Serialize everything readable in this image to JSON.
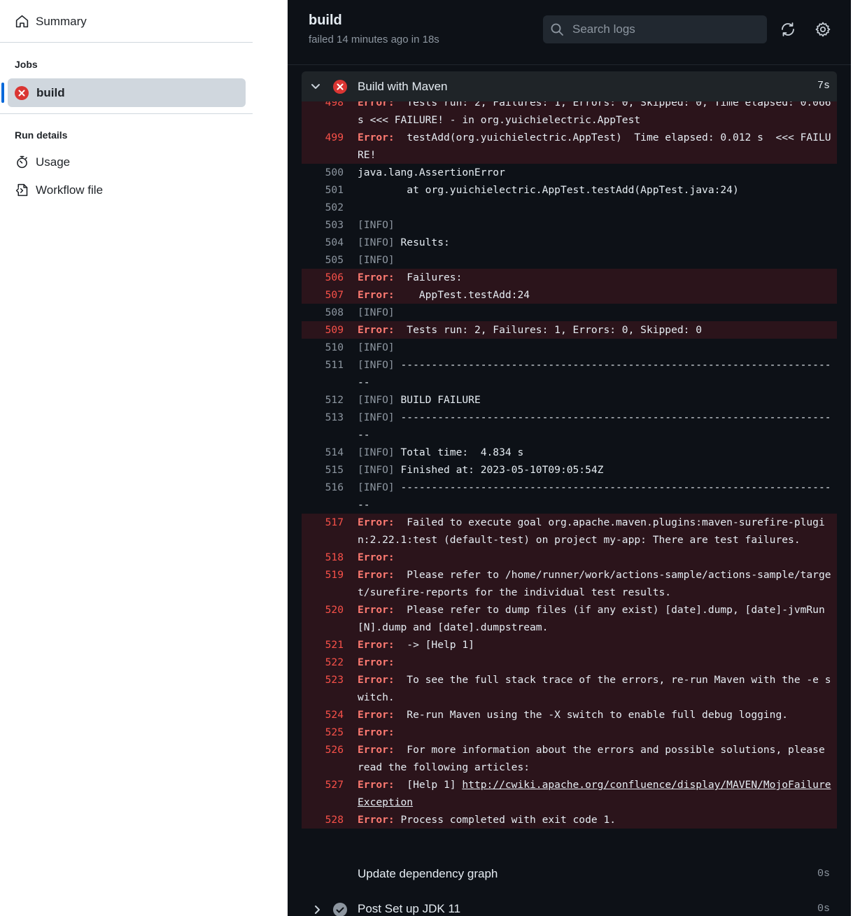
{
  "sidebar": {
    "summary_label": "Summary",
    "jobs_heading": "Jobs",
    "jobs": [
      {
        "label": "build",
        "status": "failed"
      }
    ],
    "run_details_heading": "Run details",
    "usage_label": "Usage",
    "workflow_file_label": "Workflow file"
  },
  "header": {
    "title": "build",
    "subtitle": "failed 14 minutes ago in 18s",
    "search_placeholder": "Search logs"
  },
  "step": {
    "name": "Build with Maven",
    "duration": "7s",
    "status": "failed",
    "lines": [
      {
        "num": "498",
        "err": true,
        "label": "Error:",
        "text": "  Tests run: 2, Failures: 1, Errors: 0, Skipped: 0, Time elapsed: 0.066 s <<< FAILURE! - in org.yuichielectric.AppTest"
      },
      {
        "num": "499",
        "err": true,
        "label": "Error:",
        "text": "  testAdd(org.yuichielectric.AppTest)  Time elapsed: 0.012 s  <<< FAILURE!"
      },
      {
        "num": "500",
        "err": false,
        "text": "java.lang.AssertionError"
      },
      {
        "num": "501",
        "err": false,
        "text": "\tat org.yuichielectric.AppTest.testAdd(AppTest.java:24)"
      },
      {
        "num": "502",
        "err": false,
        "text": ""
      },
      {
        "num": "503",
        "err": false,
        "info": "[INFO]",
        "text": ""
      },
      {
        "num": "504",
        "err": false,
        "info": "[INFO]",
        "text": " Results:"
      },
      {
        "num": "505",
        "err": false,
        "info": "[INFO]",
        "text": ""
      },
      {
        "num": "506",
        "err": true,
        "label": "Error:",
        "text": "  Failures: "
      },
      {
        "num": "507",
        "err": true,
        "label": "Error:",
        "text": "    AppTest.testAdd:24"
      },
      {
        "num": "508",
        "err": false,
        "info": "[INFO]",
        "text": ""
      },
      {
        "num": "509",
        "err": true,
        "label": "Error:",
        "text": "  Tests run: 2, Failures: 1, Errors: 0, Skipped: 0"
      },
      {
        "num": "510",
        "err": false,
        "info": "[INFO]",
        "text": ""
      },
      {
        "num": "511",
        "err": false,
        "info": "[INFO]",
        "text": " ------------------------------------------------------------------------"
      },
      {
        "num": "512",
        "err": false,
        "info": "[INFO]",
        "text": " BUILD FAILURE"
      },
      {
        "num": "513",
        "err": false,
        "info": "[INFO]",
        "text": " ------------------------------------------------------------------------"
      },
      {
        "num": "514",
        "err": false,
        "info": "[INFO]",
        "text": " Total time:  4.834 s"
      },
      {
        "num": "515",
        "err": false,
        "info": "[INFO]",
        "text": " Finished at: 2023-05-10T09:05:54Z"
      },
      {
        "num": "516",
        "err": false,
        "info": "[INFO]",
        "text": " ------------------------------------------------------------------------"
      },
      {
        "num": "517",
        "err": true,
        "label": "Error:",
        "text": "  Failed to execute goal org.apache.maven.plugins:maven-surefire-plugin:2.22.1:test (default-test) on project my-app: There are test failures."
      },
      {
        "num": "518",
        "err": true,
        "label": "Error:",
        "text": " "
      },
      {
        "num": "519",
        "err": true,
        "label": "Error:",
        "text": "  Please refer to /home/runner/work/actions-sample/actions-sample/target/surefire-reports for the individual test results."
      },
      {
        "num": "520",
        "err": true,
        "label": "Error:",
        "text": "  Please refer to dump files (if any exist) [date].dump, [date]-jvmRun[N].dump and [date].dumpstream."
      },
      {
        "num": "521",
        "err": true,
        "label": "Error:",
        "text": "  -> [Help 1]"
      },
      {
        "num": "522",
        "err": true,
        "label": "Error:",
        "text": " "
      },
      {
        "num": "523",
        "err": true,
        "label": "Error:",
        "text": "  To see the full stack trace of the errors, re-run Maven with the -e switch."
      },
      {
        "num": "524",
        "err": true,
        "label": "Error:",
        "text": "  Re-run Maven using the -X switch to enable full debug logging."
      },
      {
        "num": "525",
        "err": true,
        "label": "Error:",
        "text": " "
      },
      {
        "num": "526",
        "err": true,
        "label": "Error:",
        "text": "  For more information about the errors and possible solutions, please read the following articles:"
      },
      {
        "num": "527",
        "err": true,
        "label": "Error:",
        "text": "  [Help 1] ",
        "link": "http://cwiki.apache.org/confluence/display/MAVEN/MojoFailureException"
      },
      {
        "num": "528",
        "err": true,
        "label": "Error:",
        "text": " Process completed with exit code 1."
      }
    ]
  },
  "other_steps": [
    {
      "name": "Update dependency graph",
      "duration": "0s",
      "status": "none"
    },
    {
      "name": "Post Set up JDK 11",
      "duration": "0s",
      "status": "success"
    }
  ],
  "colors": {
    "log_bg": "#0d1117",
    "error_row_bg": "#2b141b",
    "error_text": "#ff7b72",
    "failure_icon": "#da3633",
    "accent": "#0969da"
  }
}
